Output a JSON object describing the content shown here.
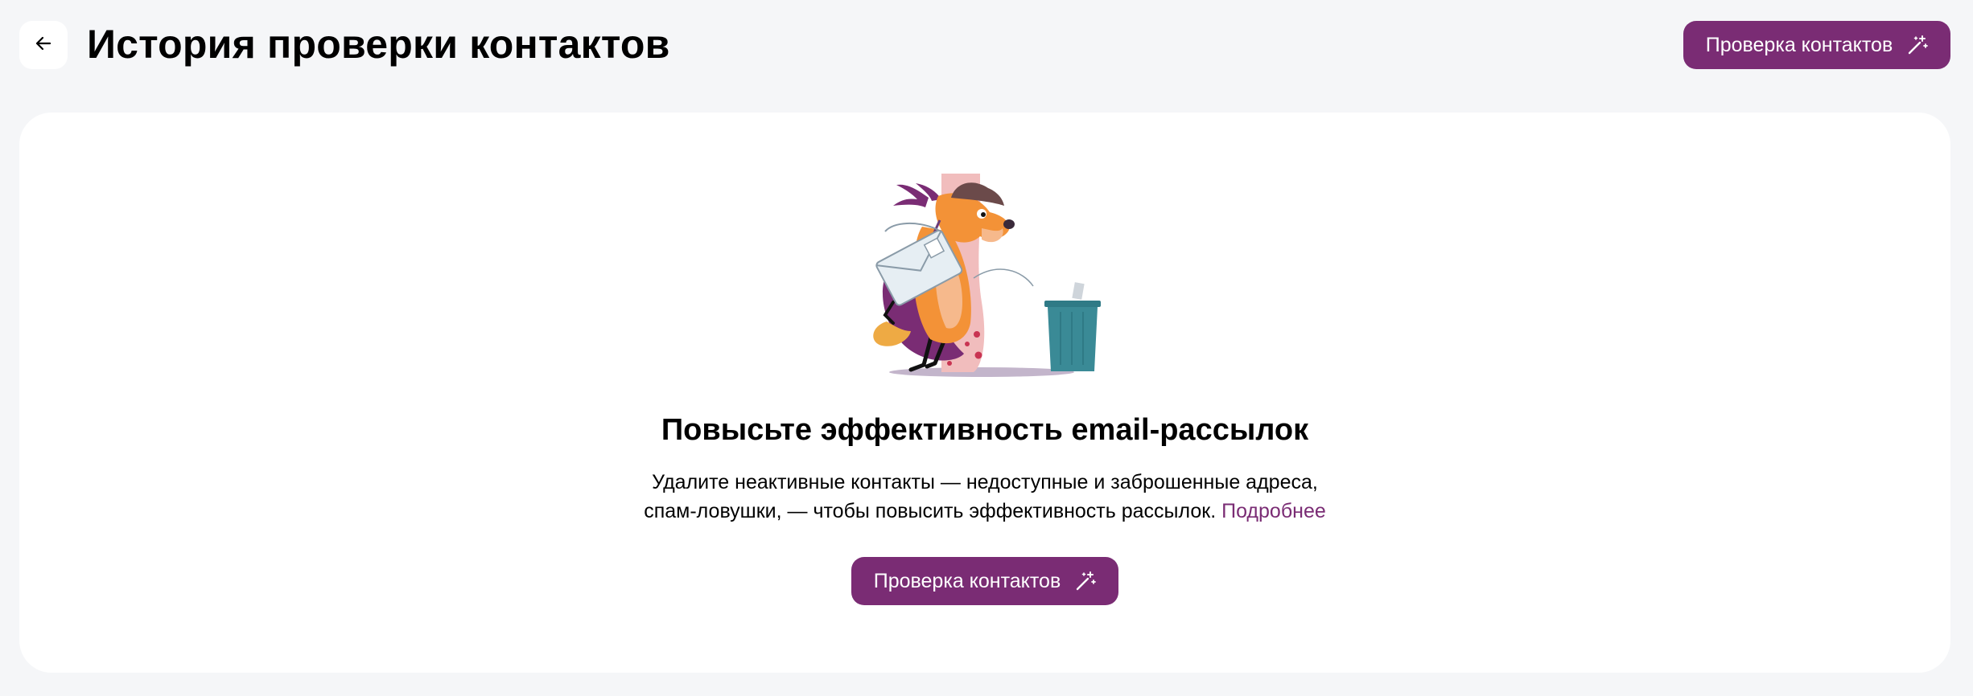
{
  "header": {
    "title": "История проверки контактов",
    "back_icon": "arrow-left-icon",
    "action_label": "Проверка контактов",
    "action_icon": "magic-wand-icon"
  },
  "empty_state": {
    "illustration": "dog-courier-trash-illustration",
    "title": "Повысьте эффективность email-рассылок",
    "description_line1": "Удалите неактивные контакты — недоступные и заброшенные адреса,",
    "description_line2": "спам-ловушки, — чтобы повысить эффективность рассылок.",
    "more_link": "Подробнее",
    "action_label": "Проверка контактов"
  },
  "colors": {
    "accent": "#7a2c74",
    "background": "#f5f6f8",
    "card": "#ffffff"
  }
}
